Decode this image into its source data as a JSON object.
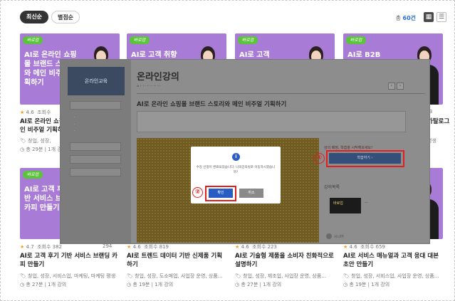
{
  "sort": {
    "latest": "최신순",
    "rating": "별점순"
  },
  "total": {
    "prefix": "총 ",
    "count": "60건"
  },
  "cards_top": [
    {
      "title_thumb": "AI로 온라인 쇼핑몰 브랜드 스토리와 메인 비주얼 기획하기",
      "rating": "4.6",
      "views": "조회수",
      "title": "AI로 온라인 쇼핑",
      "title2": "인 비주얼 기획하",
      "tags": "창업, 성장,",
      "info": "총 29분 | 1개 강의"
    },
    {
      "title_thumb": "AI로 고객 취향",
      "badge": "바로업"
    },
    {
      "title_thumb": "AI로 고객",
      "badge": "바로업"
    },
    {
      "title_thumb": "AI로 B2B",
      "views_right": "243",
      "title_right": "카탈로그",
      "tags_right": "평생"
    }
  ],
  "cards_bottom": [
    {
      "title_thumb": "AI로 고객 후기 기반 서비스 브랜딩 카피 만들기",
      "rating": "4.7",
      "views": "조회수 382",
      "views_right": "294",
      "title": "AI로 고객 후기 기반 서비스 브랜딩 카피 만들기",
      "tags": "창업, 성장, 서비스업, 마케팅, 마케팅 평생",
      "duration": "총 27분",
      "lectures": "1개 강의"
    },
    {
      "rating": "4.6",
      "views": "조회수 819",
      "title": "AI로 트렌드 데이터 기반 신제품 기획하기",
      "tags": "창업, 성장, 도소매업, 사업장 운영, 상품...",
      "duration": "총 19분",
      "lectures": "1개 강의"
    },
    {
      "rating": "4.6",
      "views": "조회수 223",
      "title": "AI로 기술형 제품을 소비자 친화적으로 설명하기",
      "tags": "창업, 성장, 제조업, 사업장 운영, 상품...",
      "duration": "총 27분",
      "lectures": "1개 강의"
    },
    {
      "rating": "4.6",
      "views": "조회수 659",
      "title": "AI로 서비스 매뉴얼과 고객 응대 대본 초안 만들기",
      "tags": "창업, 성장, 서비스업, 사업장 운영, 상품...",
      "duration": "총 19분",
      "lectures": "1개 강의"
    }
  ],
  "badge": "바로업",
  "overlay": {
    "logo": "온라인교육",
    "heading": "온라인강의",
    "title": "AI로 온라인 쇼핑몰 브랜드 스토리와 메인 비주얼 기획하기",
    "right_label": "강의 배정, 학습을 시작해보세요!",
    "right_button": "학습하기 ›",
    "list_label": "강의목록",
    "author": "시니어",
    "num1": "①",
    "num2": "②"
  },
  "modal": {
    "message": "수강 신청이 완료되었습니다. 나의강의실로 이동하시겠습니까?",
    "ok": "확인",
    "cancel": "취소",
    "icon": "i"
  },
  "colors": {
    "thumb": "#a77bd6",
    "accent": "#2a5dc4",
    "highlight": "#e02020",
    "badge": "#5cc43a"
  }
}
